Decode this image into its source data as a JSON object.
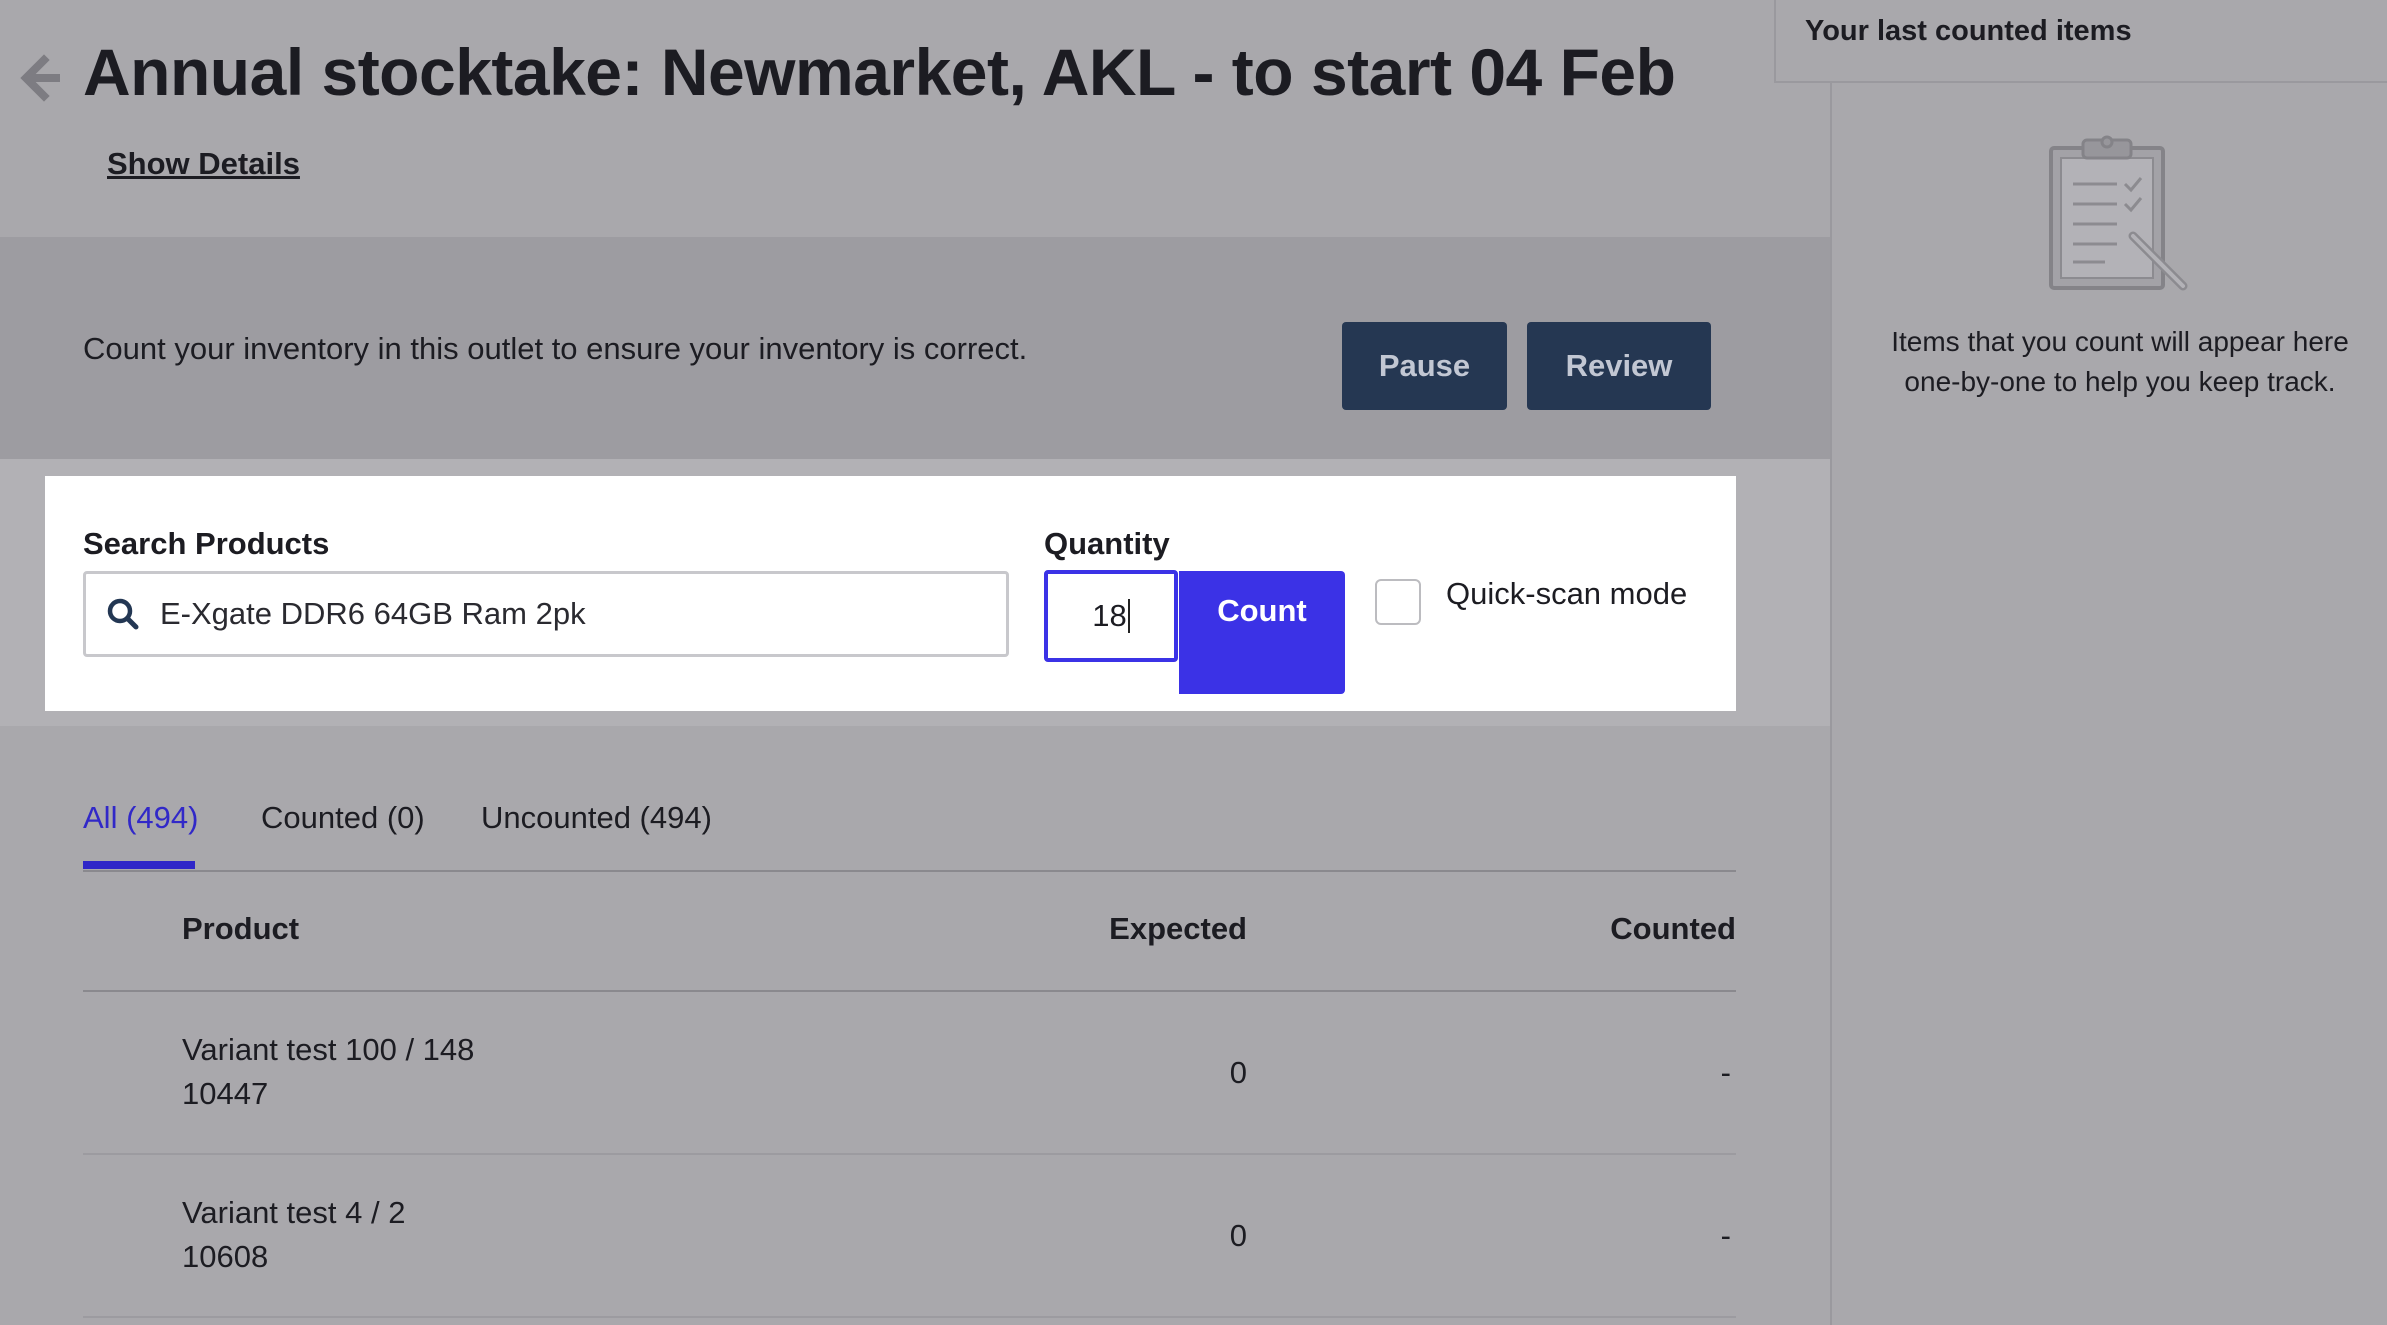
{
  "header": {
    "title": "Annual stocktake: Newmarket, AKL - to start 04 Feb",
    "show_details": "Show Details"
  },
  "banner": {
    "text": "Count your inventory in this outlet to ensure your inventory is correct.",
    "pause_label": "Pause",
    "review_label": "Review"
  },
  "search": {
    "label": "Search Products",
    "value": "E-Xgate DDR6 64GB Ram 2pk",
    "quantity_label": "Quantity",
    "quantity_value": "18",
    "count_label": "Count",
    "quick_scan_label": "Quick-scan mode",
    "quick_scan_checked": false
  },
  "tabs": [
    {
      "label": "All (494)",
      "active": true
    },
    {
      "label": "Counted (0)",
      "active": false
    },
    {
      "label": "Uncounted (494)",
      "active": false
    }
  ],
  "table": {
    "columns": [
      "Product",
      "Expected",
      "Counted"
    ],
    "rows": [
      {
        "name": "Variant test 100 / 148",
        "sku": "10447",
        "expected": "0",
        "counted": "-"
      },
      {
        "name": "Variant test 4 / 2",
        "sku": "10608",
        "expected": "0",
        "counted": "-"
      }
    ]
  },
  "sidebar": {
    "title": "Your last counted items",
    "empty_text": "Items that you count will appear here one-by-one to help you keep track.",
    "empty_icon": "clipboard-icon"
  },
  "colors": {
    "accent": "#3b32e6",
    "dark_button": "#253752",
    "overlay_background": "#a9a8ac"
  }
}
